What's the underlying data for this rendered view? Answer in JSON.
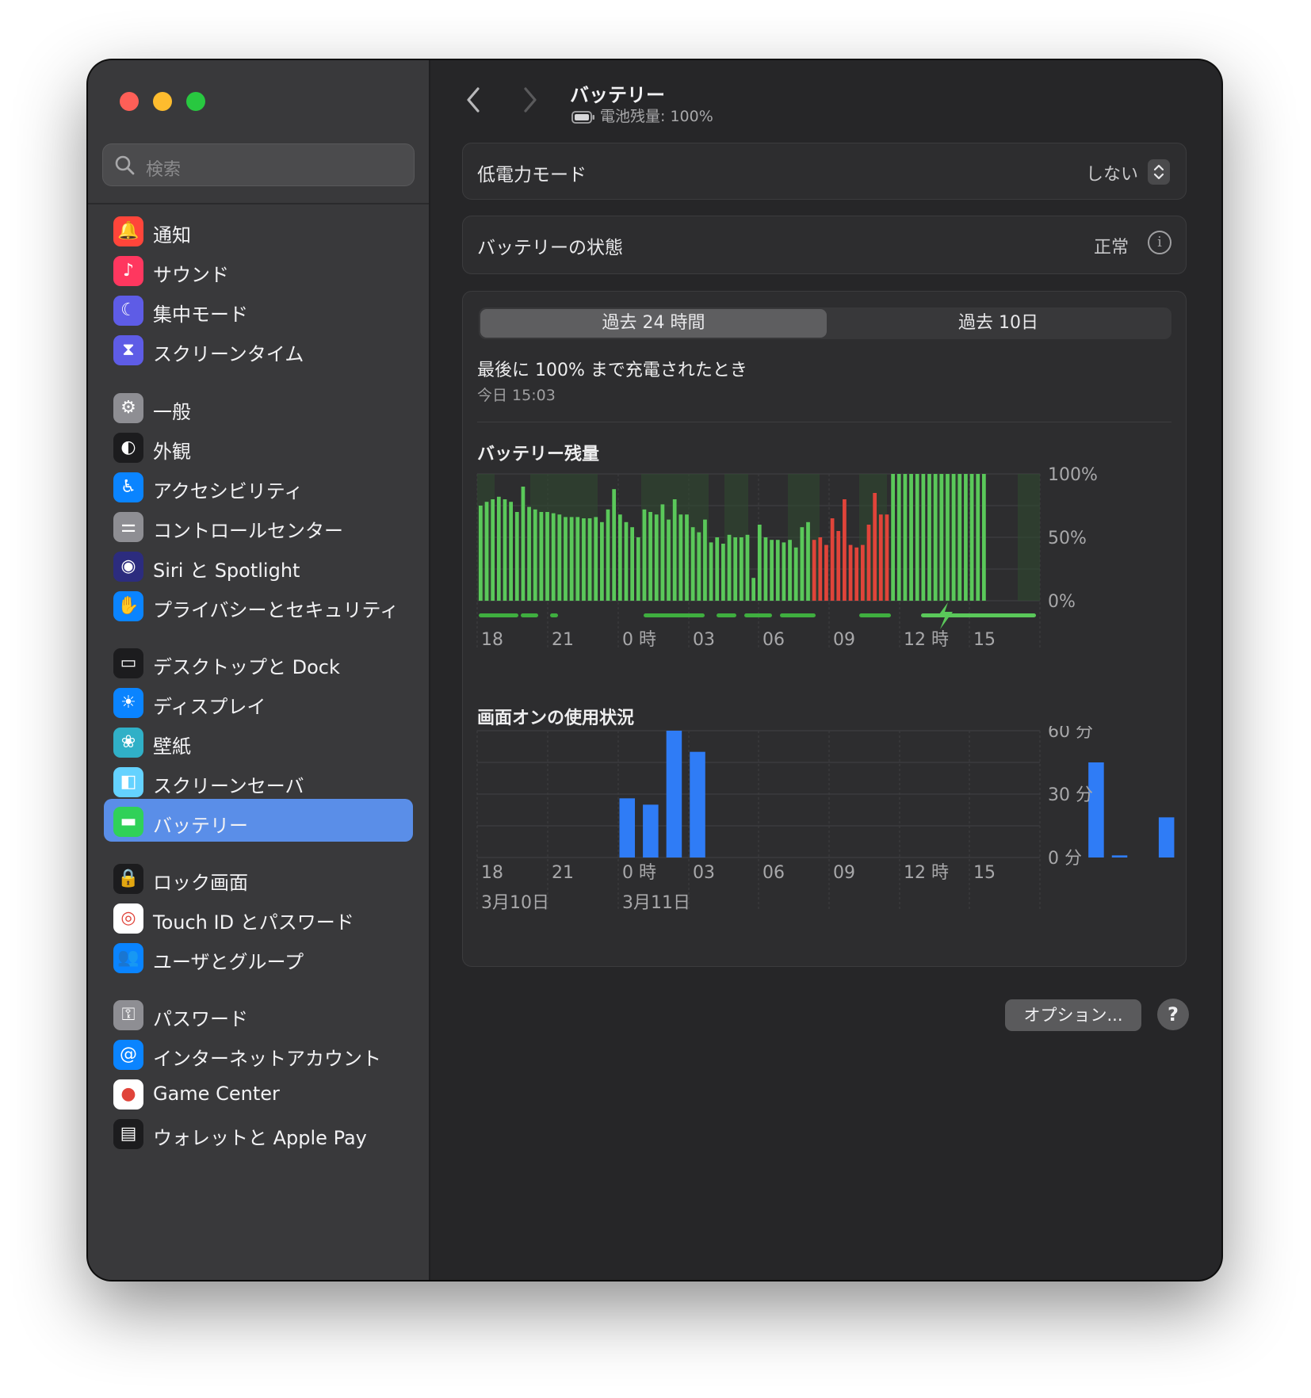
{
  "sidebar": {
    "search_placeholder": "検索",
    "items": [
      {
        "label": "通知",
        "icon": "bell-icon",
        "color": "#ff453a"
      },
      {
        "label": "サウンド",
        "icon": "speaker-icon",
        "color": "#ff375f"
      },
      {
        "label": "集中モード",
        "icon": "moon-icon",
        "color": "#5e5ce6"
      },
      {
        "label": "スクリーンタイム",
        "icon": "hourglass-icon",
        "color": "#5e5ce6"
      },
      {
        "label": "一般",
        "icon": "gear-icon",
        "color": "#8e8e93"
      },
      {
        "label": "外観",
        "icon": "appearance-icon",
        "color": "#1c1c1e"
      },
      {
        "label": "アクセシビリティ",
        "icon": "accessibility-icon",
        "color": "#0a84ff"
      },
      {
        "label": "コントロールセンター",
        "icon": "toggles-icon",
        "color": "#8e8e93"
      },
      {
        "label": "Siri と Spotlight",
        "icon": "siri-icon",
        "color": "#2c2c7e"
      },
      {
        "label": "プライバシーとセキュリティ",
        "icon": "hand-icon",
        "color": "#0a84ff"
      },
      {
        "label": "デスクトップと Dock",
        "icon": "dock-icon",
        "color": "#1c1c1e"
      },
      {
        "label": "ディスプレイ",
        "icon": "sun-icon",
        "color": "#0a84ff"
      },
      {
        "label": "壁紙",
        "icon": "flower-icon",
        "color": "#30b0c7"
      },
      {
        "label": "スクリーンセーバ",
        "icon": "screensaver-icon",
        "color": "#64d2ff"
      },
      {
        "label": "バッテリー",
        "icon": "battery-icon",
        "color": "#30d158",
        "selected": true
      },
      {
        "label": "ロック画面",
        "icon": "lock-icon",
        "color": "#1c1c1e"
      },
      {
        "label": "Touch ID とパスワード",
        "icon": "fingerprint-icon",
        "color": "#ffffff"
      },
      {
        "label": "ユーザとグループ",
        "icon": "users-icon",
        "color": "#0a84ff"
      },
      {
        "label": "パスワード",
        "icon": "key-icon",
        "color": "#8e8e93"
      },
      {
        "label": "インターネットアカウント",
        "icon": "at-icon",
        "color": "#0a84ff"
      },
      {
        "label": "Game Center",
        "icon": "gamecenter-icon",
        "color": "#ffffff"
      },
      {
        "label": "ウォレットと Apple Pay",
        "icon": "wallet-icon",
        "color": "#1c1c1e"
      }
    ]
  },
  "header": {
    "title": "バッテリー",
    "subtitle": "電池残量: 100%"
  },
  "low_power": {
    "label": "低電力モード",
    "value": "しない"
  },
  "battery_health": {
    "label": "バッテリーの状態",
    "value": "正常"
  },
  "tabs": {
    "active": "過去 24 時間",
    "inactive": "過去 10日"
  },
  "last_charge": {
    "title": "最後に 100% まで充電されたとき",
    "time": "今日 15:03"
  },
  "options_label": "オプション...",
  "help_label": "?",
  "chart_data": [
    {
      "type": "bar",
      "title": "バッテリー残量",
      "x_ticks": [
        "18",
        "21",
        "0 時",
        "03",
        "06",
        "09",
        "12 時",
        "15"
      ],
      "y_ticks": [
        "100%",
        "50%",
        "0%"
      ],
      "ylim": [
        0,
        100
      ],
      "colors": {
        "normal": "#5ac85a",
        "low": "#e0443a",
        "shade": "#2f4a2f"
      },
      "values": [
        75,
        78,
        80,
        82,
        80,
        78,
        70,
        90,
        74,
        72,
        70,
        70,
        69,
        68,
        66,
        66,
        66,
        65,
        65,
        66,
        62,
        72,
        88,
        68,
        62,
        58,
        50,
        72,
        70,
        68,
        76,
        64,
        80,
        68,
        68,
        58,
        54,
        64,
        46,
        50,
        45,
        52,
        50,
        50,
        52,
        18,
        60,
        50,
        48,
        48,
        46,
        48,
        42,
        58,
        62,
        48,
        50,
        44,
        65,
        55,
        80,
        44,
        42,
        44,
        60,
        85,
        68,
        68,
        100,
        100,
        100,
        100,
        100,
        100,
        100,
        100,
        100,
        100,
        100,
        100,
        100,
        100,
        100,
        100
      ],
      "low_flags": [
        0,
        0,
        0,
        0,
        0,
        0,
        0,
        0,
        0,
        0,
        0,
        0,
        0,
        0,
        0,
        0,
        0,
        0,
        0,
        0,
        0,
        0,
        0,
        0,
        0,
        0,
        0,
        0,
        0,
        0,
        0,
        0,
        0,
        0,
        0,
        0,
        0,
        0,
        0,
        0,
        0,
        0,
        0,
        0,
        0,
        0,
        0,
        0,
        0,
        0,
        0,
        0,
        0,
        0,
        0,
        1,
        1,
        1,
        1,
        1,
        1,
        1,
        1,
        1,
        1,
        1,
        1,
        1,
        0,
        0,
        0,
        0,
        0,
        0,
        0,
        0,
        0,
        0,
        0,
        0,
        0,
        0,
        0,
        0
      ]
    },
    {
      "type": "bar",
      "title": "画面オンの使用状況",
      "x_ticks": [
        "18",
        "21",
        "0 時",
        "03",
        "06",
        "09",
        "12 時",
        "15"
      ],
      "date_labels": [
        "3月10日",
        "3月11日"
      ],
      "y_ticks": [
        "60 分",
        "30 分",
        "0 分"
      ],
      "ylim": [
        0,
        60
      ],
      "color": "#2f7cf6",
      "values": [
        0,
        0,
        0,
        0,
        0,
        0,
        28,
        25,
        60,
        50,
        0,
        0,
        0,
        0,
        0,
        0,
        0,
        0,
        0,
        0,
        0,
        0,
        0,
        0,
        0,
        0,
        45,
        1,
        0,
        19,
        0,
        0,
        3,
        0
      ]
    }
  ]
}
